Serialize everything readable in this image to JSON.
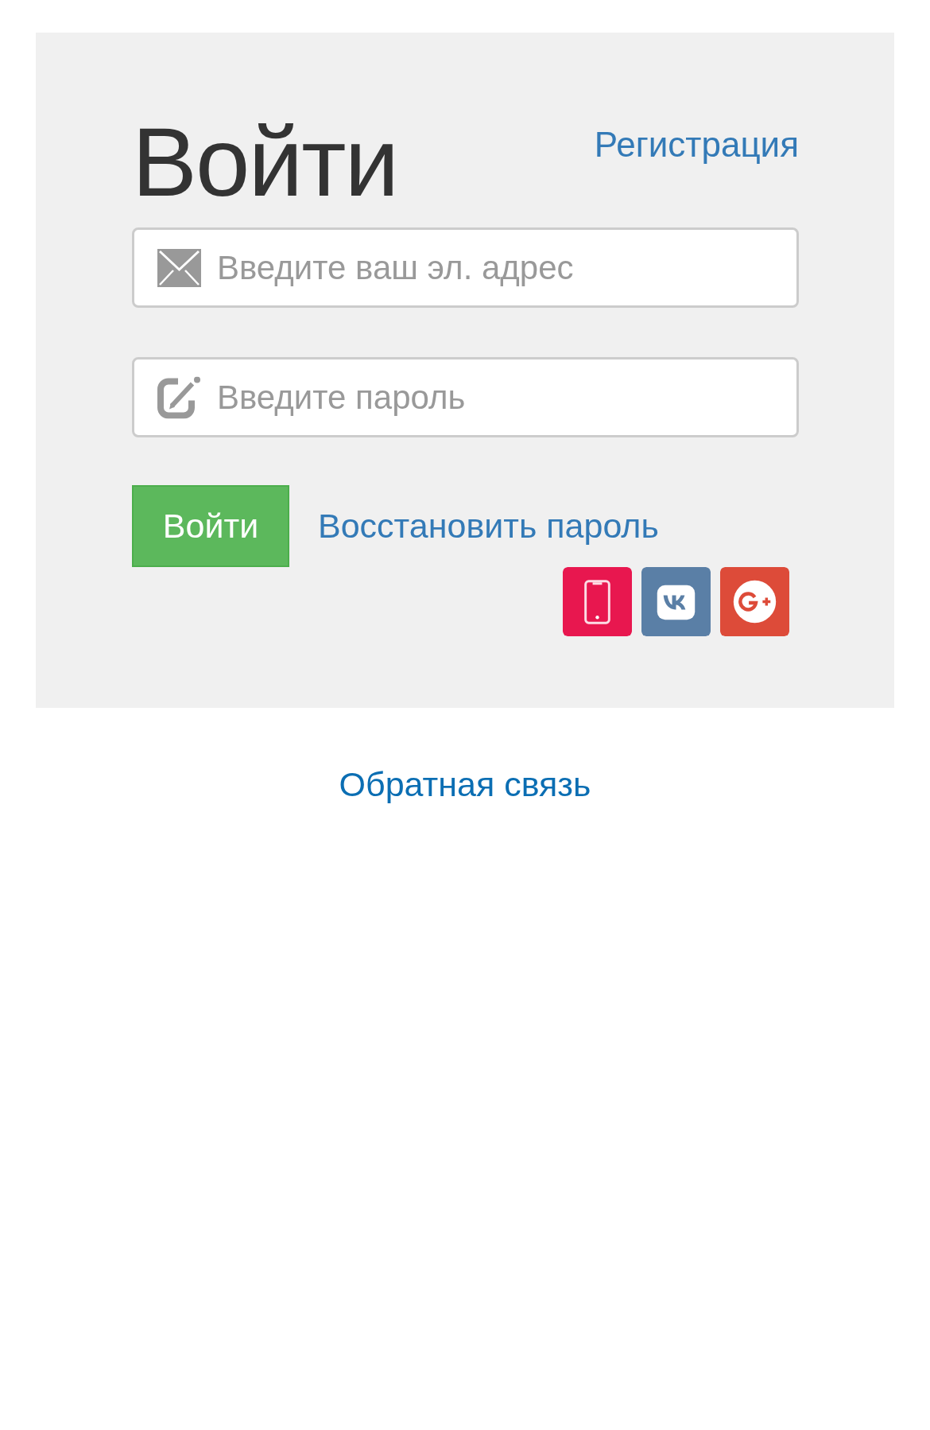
{
  "login_panel": {
    "title": "Войти",
    "register_link": "Регистрация",
    "email_field": {
      "placeholder": "Введите ваш эл. адрес"
    },
    "password_field": {
      "placeholder": "Введите пароль"
    },
    "submit_button": "Войти",
    "recover_link": "Восстановить пароль",
    "social_buttons": [
      {
        "kind": "phone"
      },
      {
        "kind": "vk"
      },
      {
        "kind": "google"
      }
    ]
  },
  "footer": {
    "feedback_link": "Обратная связь"
  }
}
